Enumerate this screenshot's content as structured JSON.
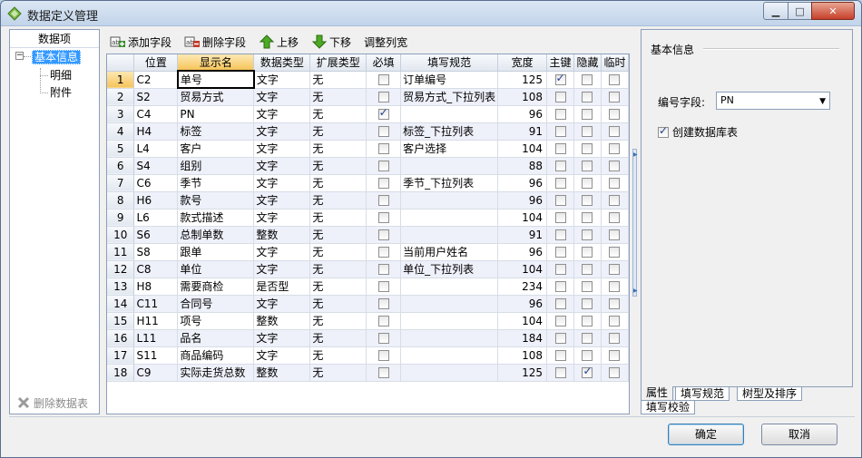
{
  "window": {
    "title": "数据定义管理",
    "controls": {
      "minimize": "▁",
      "maximize": "□",
      "close": "✕"
    }
  },
  "left_panel": {
    "header": "数据项",
    "tree": {
      "toggle": "−",
      "root": "基本信息",
      "children": [
        "明细",
        "附件"
      ]
    },
    "delete_table_label": "删除数据表"
  },
  "toolbar": {
    "add_field": "添加字段",
    "delete_field": "删除字段",
    "move_up": "上移",
    "move_down": "下移",
    "adjust_width": "调整列宽"
  },
  "grid": {
    "columns": [
      "位置",
      "显示名",
      "数据类型",
      "扩展类型",
      "必填",
      "填写规范",
      "宽度",
      "主键",
      "隐藏",
      "临时"
    ],
    "rows": [
      {
        "n": "1",
        "pos": "C2",
        "name": "单号",
        "type": "文字",
        "ext": "无",
        "req": false,
        "rule": "订单编号",
        "width": "125",
        "pk": true,
        "hidden": false,
        "temp": false
      },
      {
        "n": "2",
        "pos": "S2",
        "name": "贸易方式",
        "type": "文字",
        "ext": "无",
        "req": false,
        "rule": "贸易方式_下拉列表",
        "width": "108",
        "pk": false,
        "hidden": false,
        "temp": false
      },
      {
        "n": "3",
        "pos": "C4",
        "name": "PN",
        "type": "文字",
        "ext": "无",
        "req": true,
        "rule": "",
        "width": "96",
        "pk": false,
        "hidden": false,
        "temp": false
      },
      {
        "n": "4",
        "pos": "H4",
        "name": "标签",
        "type": "文字",
        "ext": "无",
        "req": false,
        "rule": "标签_下拉列表",
        "width": "91",
        "pk": false,
        "hidden": false,
        "temp": false
      },
      {
        "n": "5",
        "pos": "L4",
        "name": "客户",
        "type": "文字",
        "ext": "无",
        "req": false,
        "rule": "客户选择",
        "width": "104",
        "pk": false,
        "hidden": false,
        "temp": false
      },
      {
        "n": "6",
        "pos": "S4",
        "name": "组别",
        "type": "文字",
        "ext": "无",
        "req": false,
        "rule": "",
        "width": "88",
        "pk": false,
        "hidden": false,
        "temp": false
      },
      {
        "n": "7",
        "pos": "C6",
        "name": "季节",
        "type": "文字",
        "ext": "无",
        "req": false,
        "rule": "季节_下拉列表",
        "width": "96",
        "pk": false,
        "hidden": false,
        "temp": false
      },
      {
        "n": "8",
        "pos": "H6",
        "name": "款号",
        "type": "文字",
        "ext": "无",
        "req": false,
        "rule": "",
        "width": "96",
        "pk": false,
        "hidden": false,
        "temp": false
      },
      {
        "n": "9",
        "pos": "L6",
        "name": "款式描述",
        "type": "文字",
        "ext": "无",
        "req": false,
        "rule": "",
        "width": "104",
        "pk": false,
        "hidden": false,
        "temp": false
      },
      {
        "n": "10",
        "pos": "S6",
        "name": "总制单数",
        "type": "整数",
        "ext": "无",
        "req": false,
        "rule": "",
        "width": "91",
        "pk": false,
        "hidden": false,
        "temp": false
      },
      {
        "n": "11",
        "pos": "S8",
        "name": "跟单",
        "type": "文字",
        "ext": "无",
        "req": false,
        "rule": "当前用户姓名",
        "width": "96",
        "pk": false,
        "hidden": false,
        "temp": false
      },
      {
        "n": "12",
        "pos": "C8",
        "name": "单位",
        "type": "文字",
        "ext": "无",
        "req": false,
        "rule": "单位_下拉列表",
        "width": "104",
        "pk": false,
        "hidden": false,
        "temp": false
      },
      {
        "n": "13",
        "pos": "H8",
        "name": "需要商检",
        "type": "是否型",
        "ext": "无",
        "req": false,
        "rule": "",
        "width": "234",
        "pk": false,
        "hidden": false,
        "temp": false
      },
      {
        "n": "14",
        "pos": "C11",
        "name": "合同号",
        "type": "文字",
        "ext": "无",
        "req": false,
        "rule": "",
        "width": "96",
        "pk": false,
        "hidden": false,
        "temp": false
      },
      {
        "n": "15",
        "pos": "H11",
        "name": "项号",
        "type": "整数",
        "ext": "无",
        "req": false,
        "rule": "",
        "width": "104",
        "pk": false,
        "hidden": false,
        "temp": false
      },
      {
        "n": "16",
        "pos": "L11",
        "name": "品名",
        "type": "文字",
        "ext": "无",
        "req": false,
        "rule": "",
        "width": "184",
        "pk": false,
        "hidden": false,
        "temp": false
      },
      {
        "n": "17",
        "pos": "S11",
        "name": "商品编码",
        "type": "文字",
        "ext": "无",
        "req": false,
        "rule": "",
        "width": "108",
        "pk": false,
        "hidden": false,
        "temp": false
      },
      {
        "n": "18",
        "pos": "C9",
        "name": "实际走货总数",
        "type": "整数",
        "ext": "无",
        "req": false,
        "rule": "",
        "width": "125",
        "pk": false,
        "hidden": true,
        "temp": false
      }
    ]
  },
  "right_panel": {
    "group_title": "基本信息",
    "code_field_label": "编号字段:",
    "code_field_value": "PN",
    "create_table_label": "创建数据库表",
    "create_table_checked": true
  },
  "tabs": [
    "属性",
    "填写规范",
    "树型及排序",
    "填写校验"
  ],
  "buttons": {
    "ok": "确定",
    "cancel": "取消"
  },
  "colors": {
    "selection": "#3399ff",
    "header_sorted": "#f6c45a",
    "alt_row": "#eef0fa",
    "close_button": "#c7402a"
  }
}
